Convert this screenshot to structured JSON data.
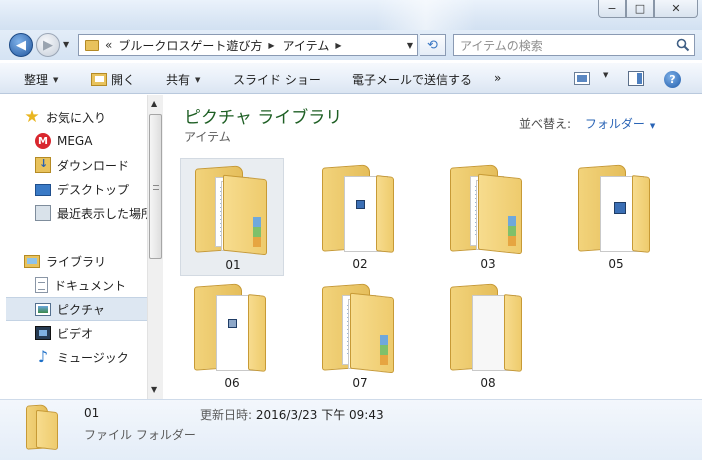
{
  "window": {
    "buttons": {
      "minimize": "−",
      "maximize": "□",
      "close": "✕"
    }
  },
  "address": {
    "chevron": "«",
    "crumbs": [
      "ブルークロスゲート遊び方",
      "アイテム"
    ],
    "search_placeholder": "アイテムの検索"
  },
  "toolbar": {
    "organize": "整理",
    "open": "開く",
    "share": "共有",
    "slideshow": "スライド ショー",
    "email": "電子メールで送信する",
    "more": "»"
  },
  "sidebar": {
    "items": [
      {
        "label": "お気に入り",
        "icon": "star-icon"
      },
      {
        "label": "MEGA",
        "icon": "mega-icon"
      },
      {
        "label": "ダウンロード",
        "icon": "download-folder-icon"
      },
      {
        "label": "デスクトップ",
        "icon": "desktop-icon"
      },
      {
        "label": "最近表示した場所",
        "icon": "recent-places-icon"
      },
      {
        "label": "ライブラリ",
        "icon": "library-icon"
      },
      {
        "label": "ドキュメント",
        "icon": "documents-icon"
      },
      {
        "label": "ピクチャ",
        "icon": "pictures-icon"
      },
      {
        "label": "ビデオ",
        "icon": "videos-icon"
      },
      {
        "label": "ミュージック",
        "icon": "music-icon"
      }
    ]
  },
  "content": {
    "library_title": "ピクチャ ライブラリ",
    "library_subtitle": "アイテム",
    "arrange_label": "並べ替え:",
    "arrange_value": "フォルダー",
    "folders": [
      "01",
      "02",
      "03",
      "05",
      "06",
      "07",
      "08"
    ]
  },
  "details": {
    "name": "01",
    "type": "ファイル フォルダー",
    "date_label": "更新日時:",
    "date_value": "2016/3/23 下午 09:43"
  },
  "colors": {
    "library_title": "#1e5f24",
    "link_blue": "#2a64b6",
    "selected_bg": "#dde7f2"
  }
}
